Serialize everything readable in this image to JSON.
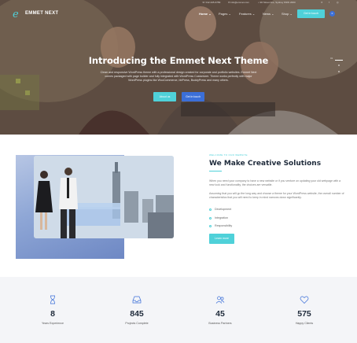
{
  "topbar": {
    "phone": "☏ 012-345-6789",
    "email": "✉ info@emmet.com",
    "address": "⌂ 96 Street Ave, Sydney NSW 2000"
  },
  "nav": {
    "logo_mark": "e",
    "logo_text": "EMMET NEXT",
    "items": [
      "Home ⌄",
      "Pages ⌄",
      "Features ⌄",
      "News ⌄",
      "Shop ⌄"
    ],
    "cta": "Get in touch",
    "cart_count": "0"
  },
  "hero": {
    "title": "Introducing the Emmet Next Theme",
    "description": "Clean and responsive WordPress theme with a professional design created for corporate and portfolio websites. Emmet Next comes packaged with page builder and fully integrated with WordPress Customizer. Theme works perfectly with major WordPress plugins like WooCommerce, bbPress, BuddyPress and many others.",
    "button_primary": "About us",
    "button_secondary": "Get in touch",
    "slide_counter": "01"
  },
  "about": {
    "eyebrow": "WELCOME TO OUR WEBSITE",
    "title": "We Make Creative Solutions",
    "paragraph1": "When you need your company to have a new website or if you venture on updating your old webpage with a new look and functionality, the choices are versatile.",
    "paragraph2": "Assuming that you will go the long way and choose a theme for your WordPress website, the overall number of characteristics that you will need to keep in mind narrows down significantly.",
    "checklist": [
      "Development",
      "Integration",
      "Responsibility"
    ],
    "button": "Learn more"
  },
  "stats": [
    {
      "icon": "hourglass-icon",
      "number": "8",
      "label": "Years Experience"
    },
    {
      "icon": "inbox-icon",
      "number": "845",
      "label": "Projects Complete"
    },
    {
      "icon": "users-icon",
      "number": "45",
      "label": "Business Partners"
    },
    {
      "icon": "heart-icon",
      "number": "575",
      "label": "Happy Clients"
    }
  ],
  "colors": {
    "accent": "#4fd1d9",
    "primary": "#3b6fd8",
    "heading": "#1e2a3a"
  }
}
